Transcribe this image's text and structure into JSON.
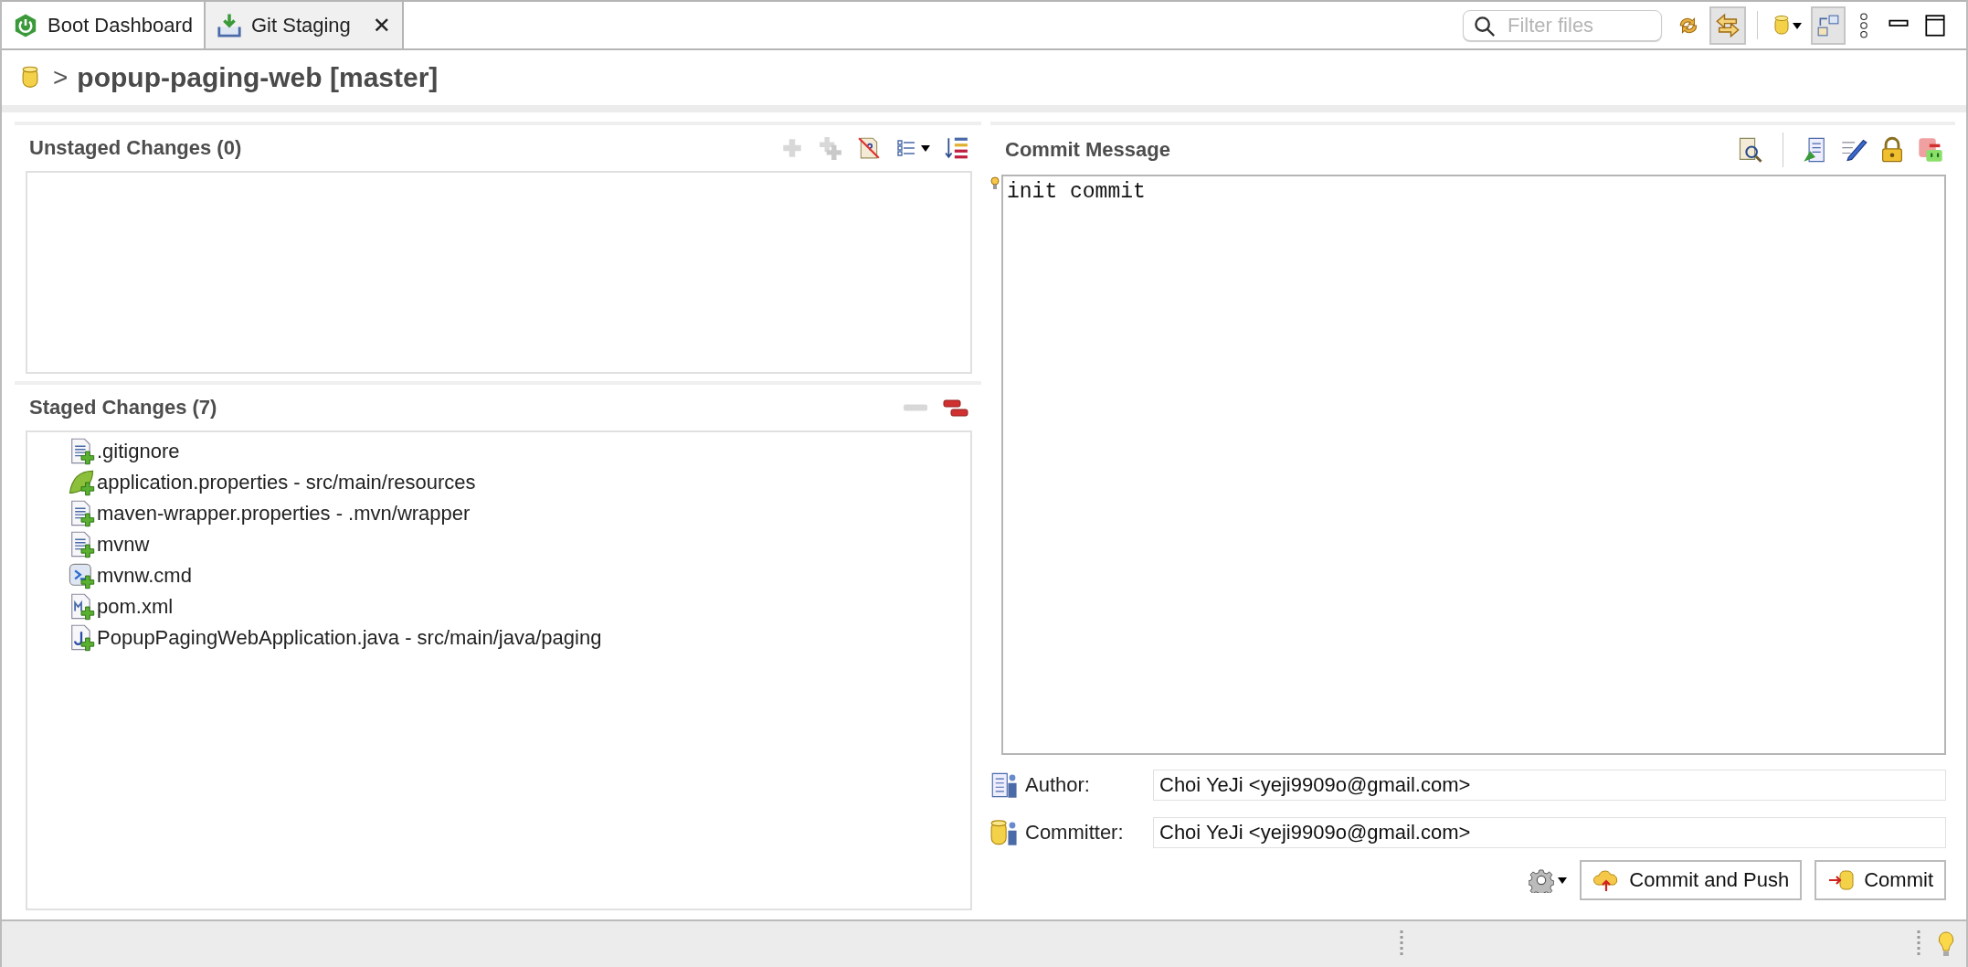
{
  "tabs": [
    {
      "label": "Boot Dashboard",
      "kind": "boot",
      "selected": false,
      "closable": false
    },
    {
      "label": "Git Staging",
      "kind": "staging",
      "selected": true,
      "closable": true
    }
  ],
  "close_glyph": "✕",
  "filter": {
    "placeholder": "Filter files"
  },
  "view_toolbar": [
    {
      "kind": "sync",
      "selected": false
    },
    {
      "kind": "compare",
      "selected": true
    },
    {
      "kind": "repo",
      "selected": false
    },
    {
      "kind": "layout",
      "selected": true
    }
  ],
  "repository": {
    "arrow": ">",
    "title": "popup-paging-web [master]"
  },
  "unstaged": {
    "title": "Unstaged Changes (0)",
    "toolbar": [
      {
        "kind": "add",
        "disabled": true
      },
      {
        "kind": "add-all",
        "disabled": true
      },
      {
        "kind": "ignore",
        "disabled": false
      },
      {
        "kind": "list",
        "disabled": false
      },
      {
        "kind": "sort",
        "disabled": false
      }
    ]
  },
  "staged": {
    "title": "Staged Changes (7)",
    "toolbar": [
      {
        "kind": "remove",
        "disabled": true
      },
      {
        "kind": "remove-all",
        "disabled": false
      }
    ],
    "files": [
      {
        "label": ".gitignore",
        "kind": "text"
      },
      {
        "label": "application.properties - src/main/resources",
        "kind": "spring"
      },
      {
        "label": "maven-wrapper.properties - .mvn/wrapper",
        "kind": "text"
      },
      {
        "label": "mvnw",
        "kind": "text"
      },
      {
        "label": "mvnw.cmd",
        "kind": "cmd"
      },
      {
        "label": "pom.xml",
        "kind": "xml"
      },
      {
        "label": "PopupPagingWebApplication.java - src/main/java/paging",
        "kind": "java"
      }
    ]
  },
  "commit": {
    "title": "Commit Message",
    "message": "init commit",
    "author": {
      "label": "Author:",
      "value": "Choi YeJi <yeji9909o@gmail.com>"
    },
    "committer": {
      "label": "Committer:",
      "value": "Choi YeJi <yeji9909o@gmail.com>"
    },
    "buttons": [
      {
        "label": "Commit and Push",
        "kind": "push"
      },
      {
        "label": "Commit",
        "kind": "commit"
      }
    ]
  }
}
